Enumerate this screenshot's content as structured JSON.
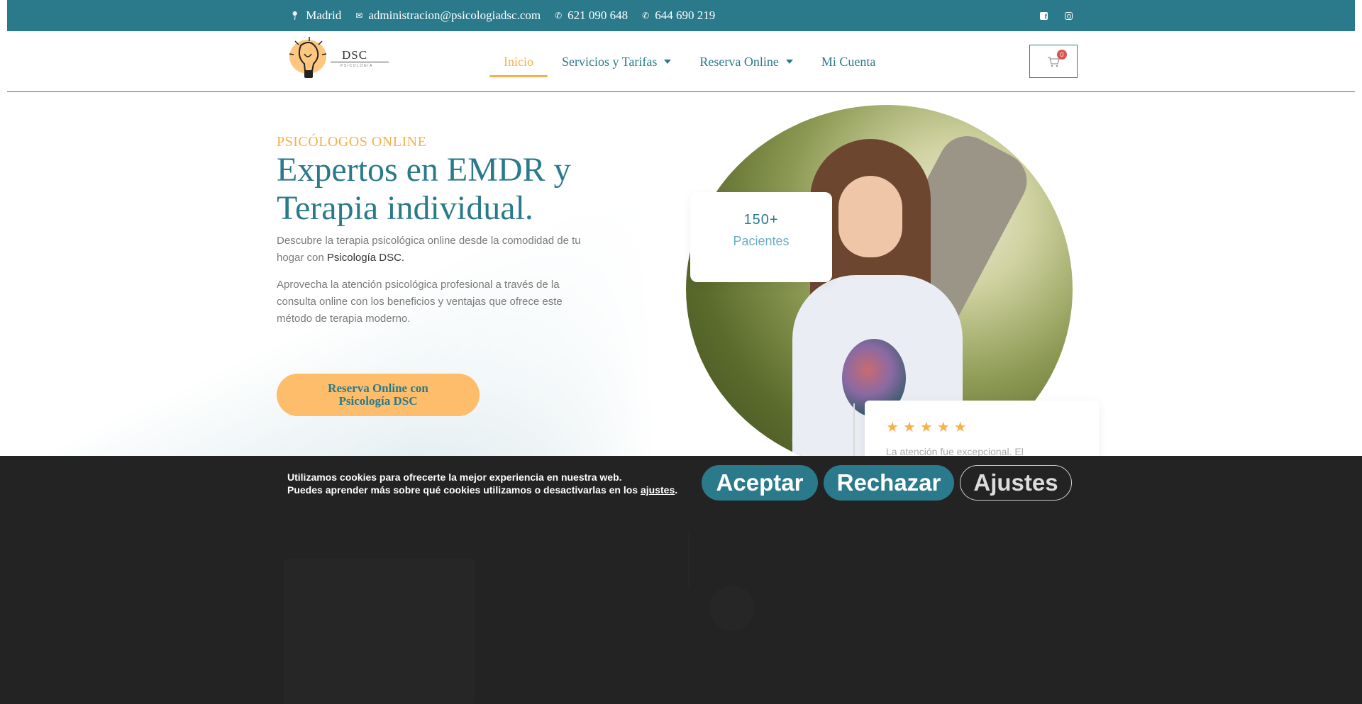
{
  "topbar": {
    "location": "Madrid",
    "email": "administracion@psicologiadsc.com",
    "phone1": "621 090 648",
    "phone2": "644 690 219",
    "location_icon": "map-pin-icon",
    "email_icon": "envelope-icon",
    "phone_icon": "phone-icon",
    "social": [
      "facebook-icon",
      "instagram-icon"
    ]
  },
  "header": {
    "logo_text": "DSC",
    "logo_sub": "PSICOLOGÍA",
    "nav": [
      {
        "label": "Inicio",
        "active": true,
        "dropdown": false
      },
      {
        "label": "Servicios y Tarifas",
        "active": false,
        "dropdown": true
      },
      {
        "label": "Reserva Online",
        "active": false,
        "dropdown": true
      },
      {
        "label": "Mi Cuenta",
        "active": false,
        "dropdown": false
      }
    ],
    "cart_count": "0"
  },
  "hero": {
    "eyebrow": "PSICÓLOGOS ONLINE",
    "title": "Expertos en EMDR y Terapia individual.",
    "p1_text": "Descubre la terapia psicológica online desde la comodidad de tu hogar con ",
    "p1_highlight": "Psicología DSC.",
    "p2": "Aprovecha la atención psicológica profesional a través de la consulta online con los beneficios y ventajas que ofrece este método de terapia moderno.",
    "cta": "Reserva Online con Psicología DSC",
    "stat_number": "150+",
    "stat_label": "Pacientes",
    "review_stars": 5,
    "review_text": "La atención fue excepcional. El"
  },
  "cookie": {
    "line1": "Utilizamos cookies para ofrecerte la mejor experiencia en nuestra web.",
    "line2_prefix": "Puedes aprender más sobre qué cookies utilizamos o desactivarlas en los ",
    "line2_link": "ajustes",
    "line2_suffix": ".",
    "accept": "Aceptar",
    "reject": "Rechazar",
    "settings": "Ajustes"
  },
  "colors": {
    "primary": "#2a7a8c",
    "accent": "#f7b04a",
    "button": "#fdbd6a",
    "cookie_bg": "#232323"
  }
}
